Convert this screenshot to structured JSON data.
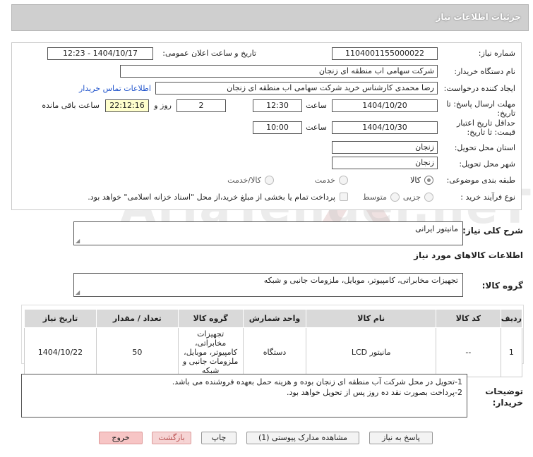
{
  "header": {
    "title": "جزئیات اطلاعات نیاز"
  },
  "form": {
    "need_number_label": "شماره نیاز:",
    "need_number": "1104001155000022",
    "announce_label": "تاریخ و ساعت اعلان عمومی:",
    "announce_value": "1404/10/17 - 12:23",
    "buyer_org_label": "نام دستگاه خریدار:",
    "buyer_org": "شرکت سهامی اب منطقه ای زنجان",
    "creator_label": "ایجاد کننده درخواست:",
    "creator": "رضا محمدی کارشناس خرید شرکت سهامی اب منطقه ای زنجان",
    "contact_link": "اطلاعات تماس خریدار",
    "deadline_label": "مهلت ارسال پاسخ: تا تاریخ:",
    "deadline_date": "1404/10/20",
    "time_label": "ساعت",
    "deadline_time": "12:30",
    "days_value": "2",
    "days_label": "روز و",
    "remaining_time": "22:12:16",
    "remaining_label": "ساعت باقی مانده",
    "validity_label": "حداقل تاریخ اعتبار قیمت: تا تاریخ:",
    "validity_date": "1404/10/30",
    "validity_time": "10:00",
    "province_label": "استان محل تحویل:",
    "province": "زنجان",
    "city_label": "شهر محل تحویل:",
    "city": "زنجان",
    "category_label": "طبقه بندی موضوعی:",
    "category_options": [
      "کالا",
      "خدمت",
      "کالا/خدمت"
    ],
    "category_selected": "کالا",
    "process_label": "نوع فرآیند خرید :",
    "process_options": [
      "جزیی",
      "متوسط"
    ],
    "payment_text": "پرداخت تمام یا بخشی از مبلغ خرید،از محل \"اسناد خزانه اسلامی\" خواهد بود."
  },
  "summary": {
    "label": "شرح کلی نیاز:",
    "value": "مانیتور ایرانی"
  },
  "goods_info": {
    "title": "اطلاعات کالاهای مورد نیاز",
    "group_label": "گروه کالا:",
    "group_value": "تجهیزات مخابراتی، کامپیوتر، موبایل، ملزومات جانبی و شبکه"
  },
  "table": {
    "headers": [
      "ردیف",
      "کد کالا",
      "نام کالا",
      "واحد شمارش",
      "گروه کالا",
      "تعداد / مقدار",
      "تاریخ نیاز"
    ],
    "rows": [
      {
        "row": "1",
        "code": "--",
        "name": "مانیتور LCD",
        "unit": "دستگاه",
        "group": "تجهیزات مخابراتی، کامپیوتر، موبایل، ملزومات جانبی و شبکه",
        "quantity": "50",
        "date": "1404/10/22"
      }
    ]
  },
  "notes": {
    "label": "توضیحات خریدار:",
    "line1": "1-تحویل در محل شرکت آب منطقه ای زنجان بوده و هزینه حمل بعهده فروشنده می باشد.",
    "line2": "2-پرداخت بصورت نقد ده روز پس از تحویل خواهد بود."
  },
  "buttons": {
    "reply": "پاسخ به نیاز",
    "attachments": "مشاهده مدارک پیوستی (1)",
    "print": "چاپ",
    "back": "بازگشت",
    "exit": "خروج"
  },
  "watermark": {
    "text": "AriaTender.neT"
  },
  "colors": {
    "header_bg": "#cfcfcf",
    "link": "#2255cc",
    "highlight": "#ffffcc",
    "exit_button": "#f7c5c5"
  }
}
